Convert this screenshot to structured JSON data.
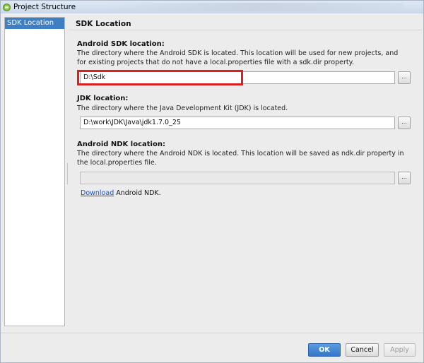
{
  "window": {
    "title": "Project Structure"
  },
  "sidebar": {
    "items": [
      {
        "label": "SDK Location",
        "selected": true
      }
    ]
  },
  "main": {
    "section_title": "SDK Location",
    "android_sdk": {
      "label": "Android SDK location:",
      "description": "The directory where the Android SDK is located. This location will be used for new projects, and for existing projects that do not have a local.properties file with a sdk.dir property.",
      "value": "D:\\Sdk",
      "browse_label": "..."
    },
    "jdk": {
      "label": "JDK location:",
      "description": "The directory where the Java Development Kit (JDK) is located.",
      "value": "D:\\work\\JDK\\Java\\jdk1.7.0_25",
      "browse_label": "..."
    },
    "android_ndk": {
      "label": "Android NDK location:",
      "description": "The directory where the Android NDK is located. This location will be saved as ndk.dir property in the local.properties file.",
      "value": "",
      "browse_label": "...",
      "download_link": "Download",
      "download_suffix": " Android NDK."
    }
  },
  "footer": {
    "ok_label": "OK",
    "cancel_label": "Cancel",
    "apply_label": "Apply"
  },
  "colors": {
    "selection": "#3e7fc4",
    "highlight": "#d92020",
    "ok_button": "#3576c7",
    "link": "#1d4fc2"
  }
}
